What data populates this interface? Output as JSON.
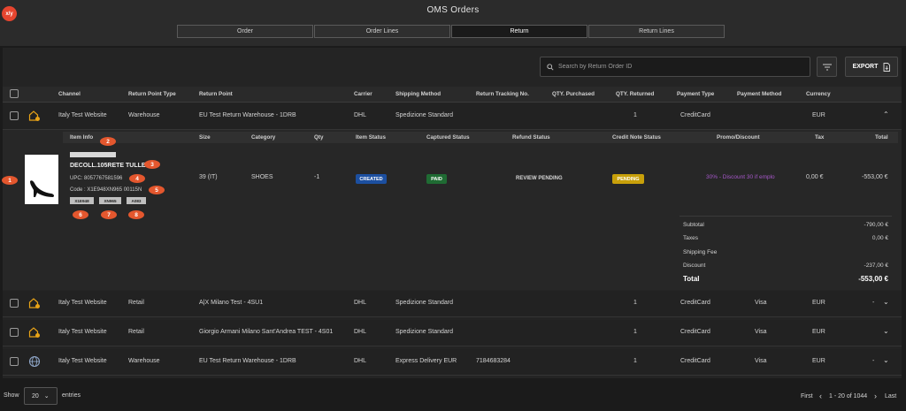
{
  "app": {
    "logo": "x/y",
    "title": "OMS Orders"
  },
  "tabs": [
    {
      "label": "Order"
    },
    {
      "label": "Order Lines"
    },
    {
      "label": "Return",
      "active": true
    },
    {
      "label": "Return Lines"
    }
  ],
  "toolbar": {
    "search_placeholder": "Search by Return Order ID",
    "export_label": "EXPORT"
  },
  "columns": [
    "Channel",
    "Return Point Type",
    "Return Point",
    "Carrier",
    "Shipping Method",
    "Return Tracking No.",
    "QTY. Purchased",
    "QTY. Returned",
    "Payment Type",
    "Payment Method",
    "Currency"
  ],
  "rows": [
    {
      "icon": "warehouse-icon",
      "channel": "Italy Test Website",
      "point_type": "Warehouse",
      "point": "EU Test Return Warehouse - 1DRB",
      "carrier": "DHL",
      "shipping": "Spedizione Standard",
      "tracking": "",
      "qty_purchased": "",
      "qty_returned": "1",
      "payment_type": "CreditCard",
      "payment_method": "",
      "currency": "EUR",
      "actions": "",
      "expanded": true
    },
    {
      "icon": "warehouse-icon",
      "channel": "Italy Test Website",
      "point_type": "Retail",
      "point": "A|X Milano Test - 4SU1",
      "carrier": "DHL",
      "shipping": "Spedizione Standard",
      "tracking": "",
      "qty_purchased": "",
      "qty_returned": "1",
      "payment_type": "CreditCard",
      "payment_method": "Visa",
      "currency": "EUR",
      "actions": "-"
    },
    {
      "icon": "warehouse-icon",
      "channel": "Italy Test Website",
      "point_type": "Retail",
      "point": "Giorgio Armani Milano Sant'Andrea TEST - 4S01",
      "carrier": "DHL",
      "shipping": "Spedizione Standard",
      "tracking": "",
      "qty_purchased": "",
      "qty_returned": "1",
      "payment_type": "CreditCard",
      "payment_method": "Visa",
      "currency": "EUR",
      "actions": ""
    },
    {
      "icon": "globe-icon",
      "channel": "Italy Test Website",
      "point_type": "Warehouse",
      "point": "EU Test Return Warehouse - 1DRB",
      "carrier": "DHL",
      "shipping": "Express Delivery EUR",
      "tracking": "7184683284",
      "qty_purchased": "",
      "qty_returned": "1",
      "payment_type": "CreditCard",
      "payment_method": "Visa",
      "currency": "EUR",
      "actions": "-"
    }
  ],
  "detail": {
    "columns": [
      "Item Info",
      "Size",
      "Category",
      "Qty",
      "Item Status",
      "Captured Status",
      "Refund Status",
      "Credit Note Status",
      "Promo/Discount",
      "Tax",
      "Total"
    ],
    "item": {
      "name": "DECOLL.105RETE TULLE",
      "upc": "UPC: 8057767581596",
      "code": "Code : X1E948XN965 00115N",
      "tags": [
        "X1E948",
        "XN965",
        "A083"
      ],
      "size": "39 (IT)",
      "category": "SHOES",
      "qty": "-1",
      "item_status": "CREATED",
      "captured_status": "PAID",
      "refund_status": "REVIEW PENDING",
      "credit_note_status": "PENDING",
      "promo": "30% - Discount 30 if emplo",
      "tax": "0,00 €",
      "total": "-553,00 €"
    },
    "summary": {
      "subtotal_label": "Subtotal",
      "subtotal": "-790,00 €",
      "taxes_label": "Taxes",
      "taxes": "0,00 €",
      "shipping_label": "Shipping Fee",
      "shipping": "",
      "discount_label": "Discount",
      "discount": "-237,00 €",
      "total_label": "Total",
      "total": "-553,00 €"
    },
    "markers": [
      "1",
      "2",
      "3",
      "4",
      "5",
      "6",
      "7",
      "8"
    ]
  },
  "footer": {
    "show_label": "Show",
    "page_size": "20",
    "entries_label": "entries",
    "first_label": "First",
    "range": "1 - 20 of 1044",
    "last_label": "Last"
  },
  "colors": {
    "background": "#1b1b1b",
    "accent": "#e4572e",
    "created": "#1c4fa0",
    "paid": "#1f6b33",
    "pending": "#c8a00a",
    "promo": "#a657c9"
  }
}
